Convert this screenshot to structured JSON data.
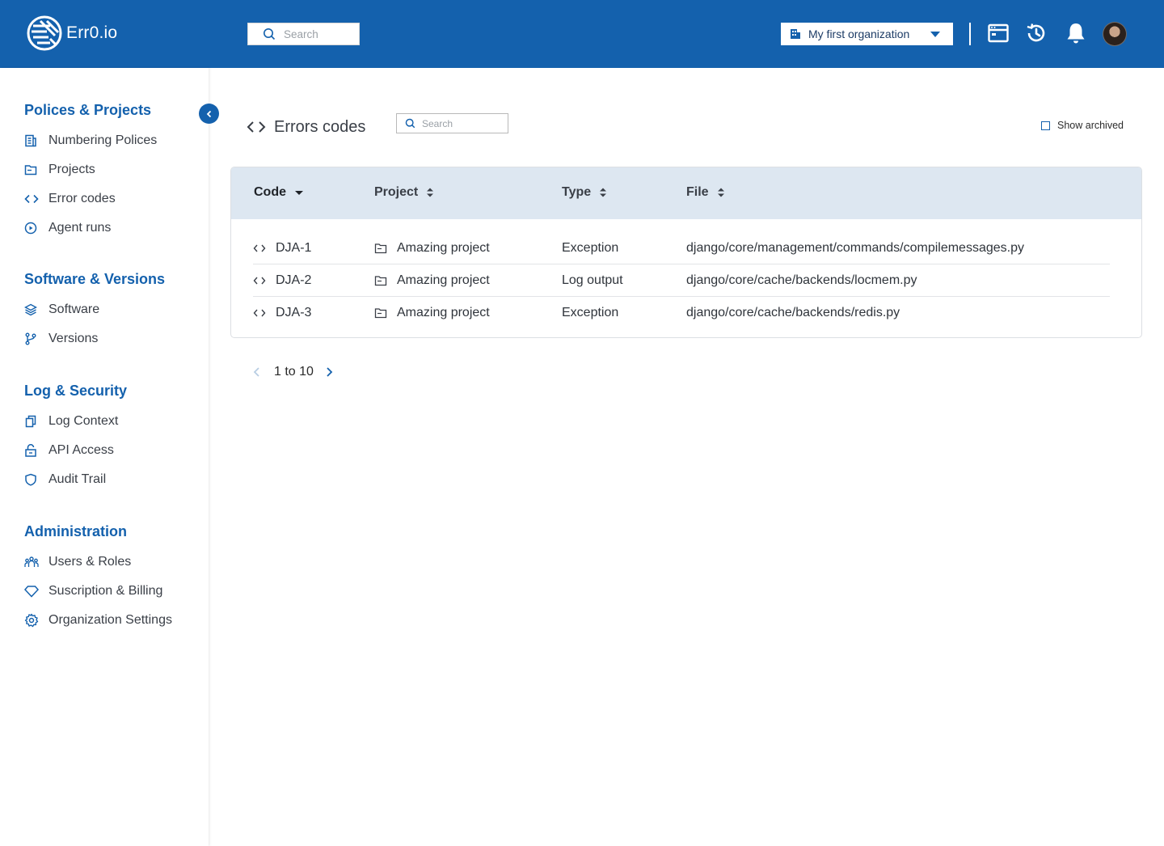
{
  "app": {
    "name": "Err0.io"
  },
  "header": {
    "search_placeholder": "Search",
    "org_selector": "My first organization",
    "icons": [
      "browser-window-icon",
      "history-icon",
      "bell-icon",
      "avatar"
    ]
  },
  "sidebar": {
    "sections": [
      {
        "title": "Polices & Projects",
        "items": [
          {
            "label": "Numbering Polices",
            "icon": "document-icon"
          },
          {
            "label": "Projects",
            "icon": "folder-icon"
          },
          {
            "label": "Error codes",
            "icon": "code-icon"
          },
          {
            "label": "Agent runs",
            "icon": "play-circle-icon"
          }
        ]
      },
      {
        "title": "Software & Versions",
        "items": [
          {
            "label": "Software",
            "icon": "layers-icon"
          },
          {
            "label": "Versions",
            "icon": "branch-icon"
          }
        ]
      },
      {
        "title": "Log & Security",
        "items": [
          {
            "label": "Log Context",
            "icon": "copy-icon"
          },
          {
            "label": "API Access",
            "icon": "unlock-icon"
          },
          {
            "label": "Audit Trail",
            "icon": "shield-icon"
          }
        ]
      },
      {
        "title": "Administration",
        "items": [
          {
            "label": "Users & Roles",
            "icon": "users-icon"
          },
          {
            "label": "Suscription & Billing",
            "icon": "diamond-icon"
          },
          {
            "label": "Organization Settings",
            "icon": "gear-icon"
          }
        ]
      }
    ]
  },
  "main": {
    "title": "Errors codes",
    "search_placeholder": "Search",
    "show_archived_label": "Show archived",
    "show_archived_checked": false,
    "table": {
      "columns": [
        "Code",
        "Project",
        "Type",
        "File"
      ],
      "sort_column": "Code",
      "rows": [
        {
          "code": "DJA-1",
          "project": "Amazing project",
          "type": "Exception",
          "file": "django/core/management/commands/compilemessages.py"
        },
        {
          "code": "DJA-2",
          "project": "Amazing project",
          "type": "Log output",
          "file": "django/core/cache/backends/locmem.py"
        },
        {
          "code": "DJA-3",
          "project": "Amazing project",
          "type": "Exception",
          "file": "django/core/cache/backends/redis.py"
        }
      ]
    },
    "pagination": {
      "label": "1 to 10"
    }
  },
  "colors": {
    "brand": "#1461ad",
    "header_row": "#dde7f1"
  }
}
